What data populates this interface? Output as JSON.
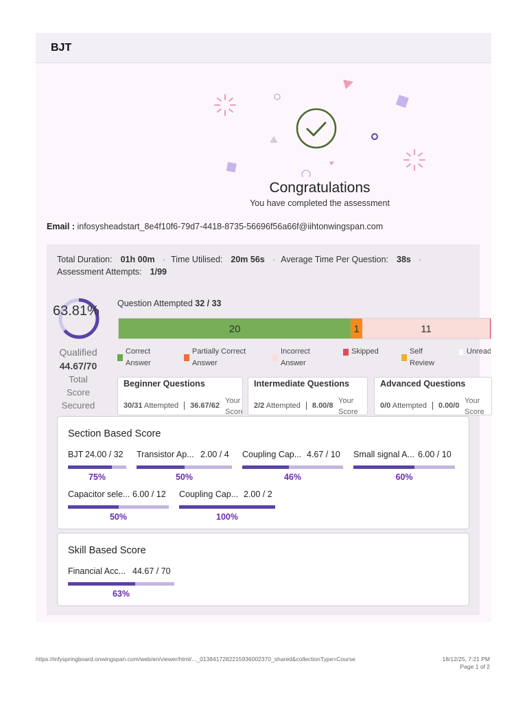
{
  "header": {
    "title": "BJT"
  },
  "hero": {
    "title": "Congratulations",
    "subtitle": "You have completed the assessment",
    "icon": "check-circle-icon"
  },
  "email": {
    "label": "Email :",
    "value": "infosysheadstart_8e4f10f6-79d7-4418-8735-56696f56a66f@iihtonwingspan.com"
  },
  "stats": {
    "total_duration_label": "Total Duration:",
    "total_duration": "01h 00m",
    "time_utilised_label": "Time Utilised:",
    "time_utilised": "20m 56s",
    "avg_time_label": "Average Time Per Question:",
    "avg_time": "38s",
    "attempts_label": "Assessment Attempts:",
    "attempts": "1/99"
  },
  "score": {
    "percent_text": "63.81%",
    "percent": 63.81,
    "status": "Qualified",
    "total": "44.67/70",
    "total_label": "Total Score Secured",
    "ring_color": "#5a43a5",
    "ring_track_color": "#cfc6ea"
  },
  "attempted": {
    "label": "Question Attempted",
    "value": "32 / 33"
  },
  "breakdown": [
    {
      "key": "correct",
      "count": 20,
      "label": "20",
      "color": "#77ae57"
    },
    {
      "key": "partial",
      "count": 1,
      "label": "1",
      "color": "#f28a1e"
    },
    {
      "key": "incorrect",
      "count": 11,
      "label": "11",
      "color": "#fadcd8"
    },
    {
      "key": "skipped",
      "count": 1,
      "label": "1",
      "color": "#e04b5c"
    }
  ],
  "legend": [
    {
      "label": "Correct\nAnswer",
      "color": "#6aa84f"
    },
    {
      "label": "Partially Correct\nAnswer",
      "color": "#f26b3a"
    },
    {
      "label": "Incorrect\nAnswer",
      "color": "#fadcd8"
    },
    {
      "label": "Skipped",
      "color": "#e04b5c"
    },
    {
      "label": "Self\nReview",
      "color": "#f0b02a"
    },
    {
      "label": "Unread",
      "color": "#ffffff"
    }
  ],
  "levels": [
    {
      "title": "Beginner Questions",
      "attempted": "30/31",
      "attempted_label": "Attempted",
      "score": "36.67/62",
      "score_label": "Your\nScore"
    },
    {
      "title": "Intermediate Questions",
      "attempted": "2/2",
      "attempted_label": "Attempted",
      "score": "8.00/8",
      "score_label": "Your\nScore"
    },
    {
      "title": "Advanced Questions",
      "attempted": "0/0",
      "attempted_label": "Attempted",
      "score": "0.00/0",
      "score_label": "Your\nScore"
    }
  ],
  "section_scores": {
    "title": "Section Based Score",
    "items": [
      {
        "name": "BJT",
        "score": "24.00 / 32",
        "percent_text": "75%",
        "percent": 75
      },
      {
        "name": "Transistor Ap...",
        "score": "2.00 / 4",
        "percent_text": "50%",
        "percent": 50
      },
      {
        "name": "Coupling Cap...",
        "score": "4.67 / 10",
        "percent_text": "46%",
        "percent": 46
      },
      {
        "name": "Small signal A...",
        "score": "6.00 / 10",
        "percent_text": "60%",
        "percent": 60
      },
      {
        "name": "Capacitor sele...",
        "score": "6.00 / 12",
        "percent_text": "50%",
        "percent": 50
      },
      {
        "name": "Coupling Cap...",
        "score": "2.00 / 2",
        "percent_text": "100%",
        "percent": 100
      }
    ]
  },
  "skill_scores": {
    "title": "Skill Based Score",
    "items": [
      {
        "name": "Financial Acc...",
        "score": "44.67 / 70",
        "percent_text": "63%",
        "percent": 63
      }
    ]
  },
  "footer": {
    "url": "https://infyspringboard.onwingspan.com/web/en/viewer/html/..._013841728221593600237​0_shared&collectionType=Course",
    "date": "18/12/25, 7:21 PM",
    "page": "Page 1 of 2"
  }
}
